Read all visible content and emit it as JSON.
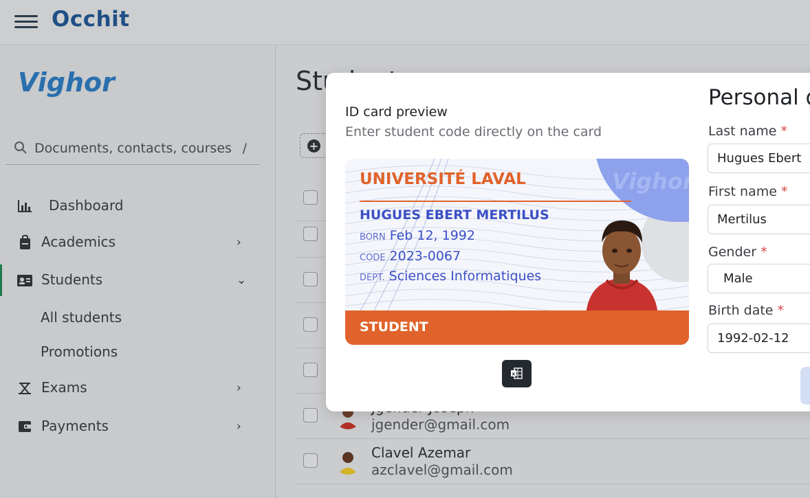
{
  "app": {
    "name": "Occhit"
  },
  "sidebar": {
    "logo": "Vighor",
    "search_placeholder": "Documents, contacts, courses",
    "search_shortcut": "/",
    "items": [
      {
        "label": "Dashboard",
        "icon": "bar-chart-icon"
      },
      {
        "label": "Academics",
        "icon": "bag-icon"
      },
      {
        "label": "Students",
        "icon": "id-card-icon"
      },
      {
        "label": "Exams",
        "icon": "exam-icon"
      },
      {
        "label": "Payments",
        "icon": "wallet-icon"
      }
    ],
    "sub_items": [
      {
        "label": "All students"
      },
      {
        "label": "Promotions"
      }
    ]
  },
  "main": {
    "page_title": "Students",
    "rows": [
      {
        "name": "",
        "email": ""
      },
      {
        "name": "",
        "email": ""
      },
      {
        "name": "",
        "email": ""
      },
      {
        "name": "",
        "email": ""
      },
      {
        "name": "",
        "email": ""
      },
      {
        "name": "Jgender Joseph",
        "email": "jgender@gmail.com"
      },
      {
        "name": "Clavel Azemar",
        "email": "azclavel@gmail.com"
      }
    ]
  },
  "modal": {
    "preview_title": "ID card preview",
    "preview_subtitle": "Enter student code directly on the card",
    "card": {
      "university": "UNIVERSITÉ LAVAL",
      "watermark": "Vighor",
      "student_name": "HUGUES EBERT MERTILUS",
      "born_key": "BORN",
      "born_value": "Feb 12, 1992",
      "code_key": "CODE",
      "code_value": "2023-0067",
      "dept_key": "DEPT.",
      "dept_value": "Sciences Informatiques",
      "footer": "STUDENT"
    },
    "form": {
      "title": "Personal details",
      "last_name_label": "Last name",
      "last_name_value": "Hugues Ebert",
      "first_name_label": "First name",
      "first_name_value": "Mertilus",
      "gender_label": "Gender",
      "gender_value": "Male",
      "birth_label": "Birth date",
      "birth_value": "1992-02-12",
      "required_mark": "*"
    }
  }
}
